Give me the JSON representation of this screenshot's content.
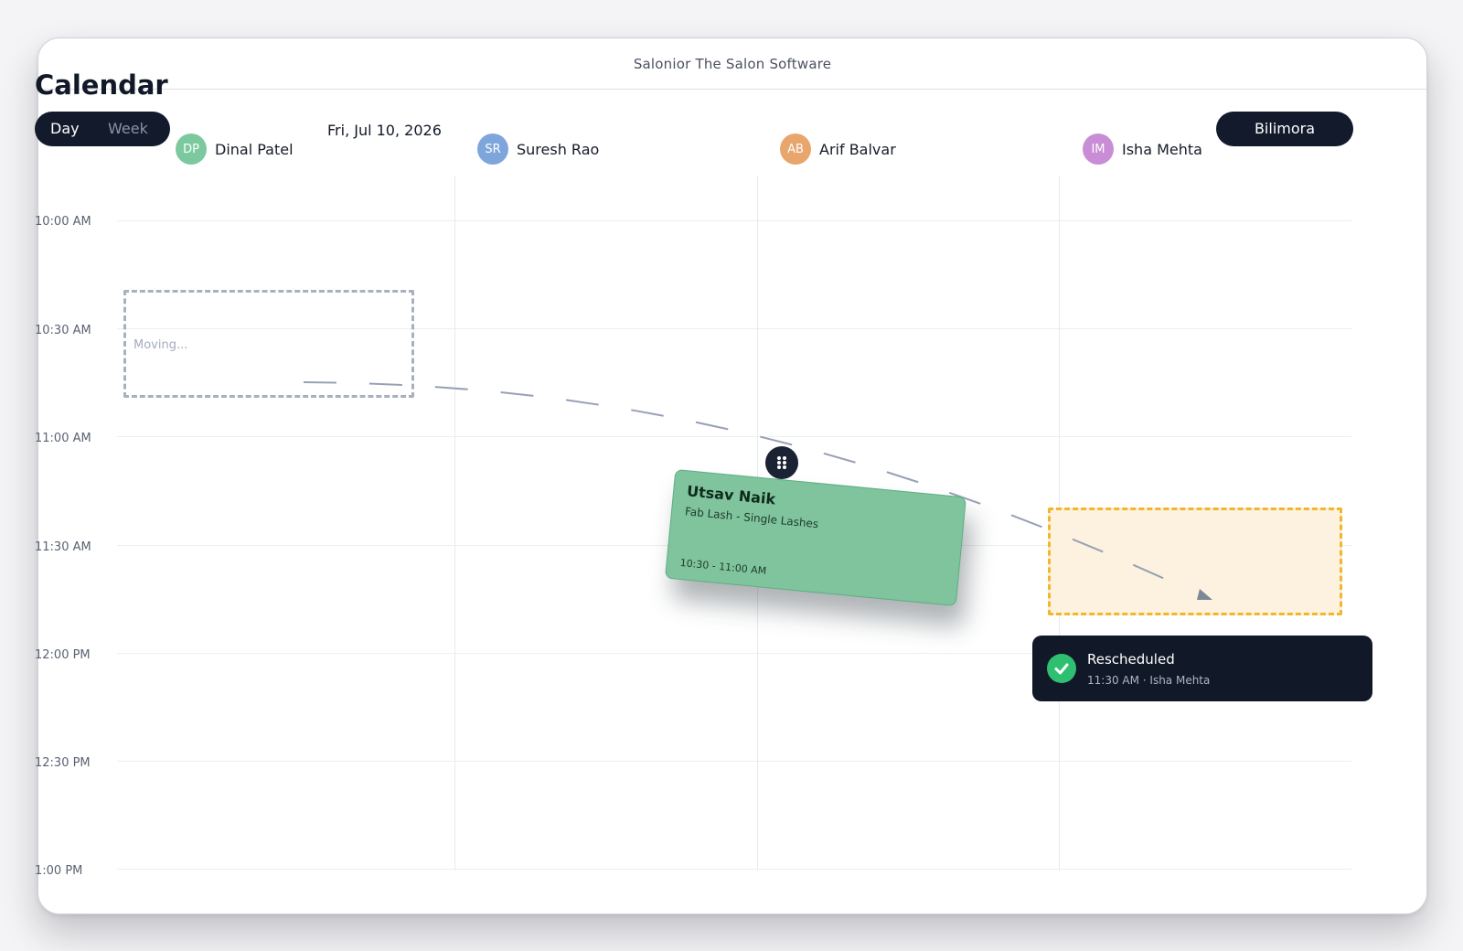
{
  "app": {
    "title": "Salonior The Salon Software"
  },
  "page": {
    "heading": "Calendar",
    "date": "Fri, Jul 10, 2026",
    "location": "Bilimora"
  },
  "view_toggle": {
    "day": "Day",
    "week": "Week",
    "selected": "Day"
  },
  "staff": [
    {
      "initials": "DP",
      "name": "Dinal Patel",
      "color": "#7cc9a0"
    },
    {
      "initials": "SR",
      "name": "Suresh Rao",
      "color": "#7fa6dc"
    },
    {
      "initials": "AB",
      "name": "Arif Balvar",
      "color": "#e8a56c"
    },
    {
      "initials": "IM",
      "name": "Isha Mehta",
      "color": "#c98dd6"
    }
  ],
  "times": [
    "10:00 AM",
    "10:30 AM",
    "11:00 AM",
    "11:30 AM",
    "12:00 PM",
    "12:30 PM",
    "1:00 PM"
  ],
  "ghost": {
    "label": "Moving..."
  },
  "appointment": {
    "client": "Utsav Naik",
    "service": "Fab Lash - Single Lashes",
    "time": "10:30 - 11:00 AM",
    "color": "#7fc49d"
  },
  "toast": {
    "title": "Rescheduled",
    "subtitle": "11:30 AM · Isha Mehta",
    "accent": "#2fbf71"
  },
  "colors": {
    "dark": "#121a2b",
    "target_border": "#f0b72b",
    "target_fill": "#fdf2df"
  }
}
